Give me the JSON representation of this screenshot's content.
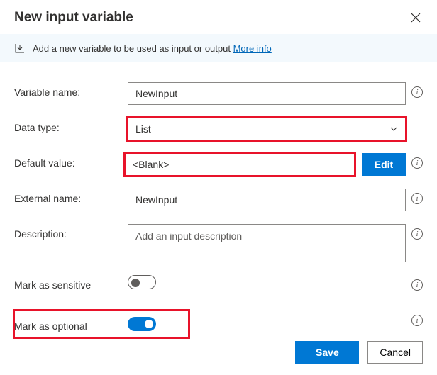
{
  "title": "New input variable",
  "banner": {
    "text": "Add a new variable to be used as input or output ",
    "link_label": "More info"
  },
  "fields": {
    "variable_name": {
      "label": "Variable name:",
      "value": "NewInput"
    },
    "data_type": {
      "label": "Data type:",
      "value": "List"
    },
    "default_value": {
      "label": "Default value:",
      "value": "<Blank>",
      "edit_label": "Edit"
    },
    "external_name": {
      "label": "External name:",
      "value": "NewInput"
    },
    "description": {
      "label": "Description:",
      "placeholder": "Add an input description"
    },
    "mark_sensitive": {
      "label": "Mark as sensitive"
    },
    "mark_optional": {
      "label": "Mark as optional"
    }
  },
  "info_glyph": "i",
  "footer": {
    "save": "Save",
    "cancel": "Cancel"
  }
}
